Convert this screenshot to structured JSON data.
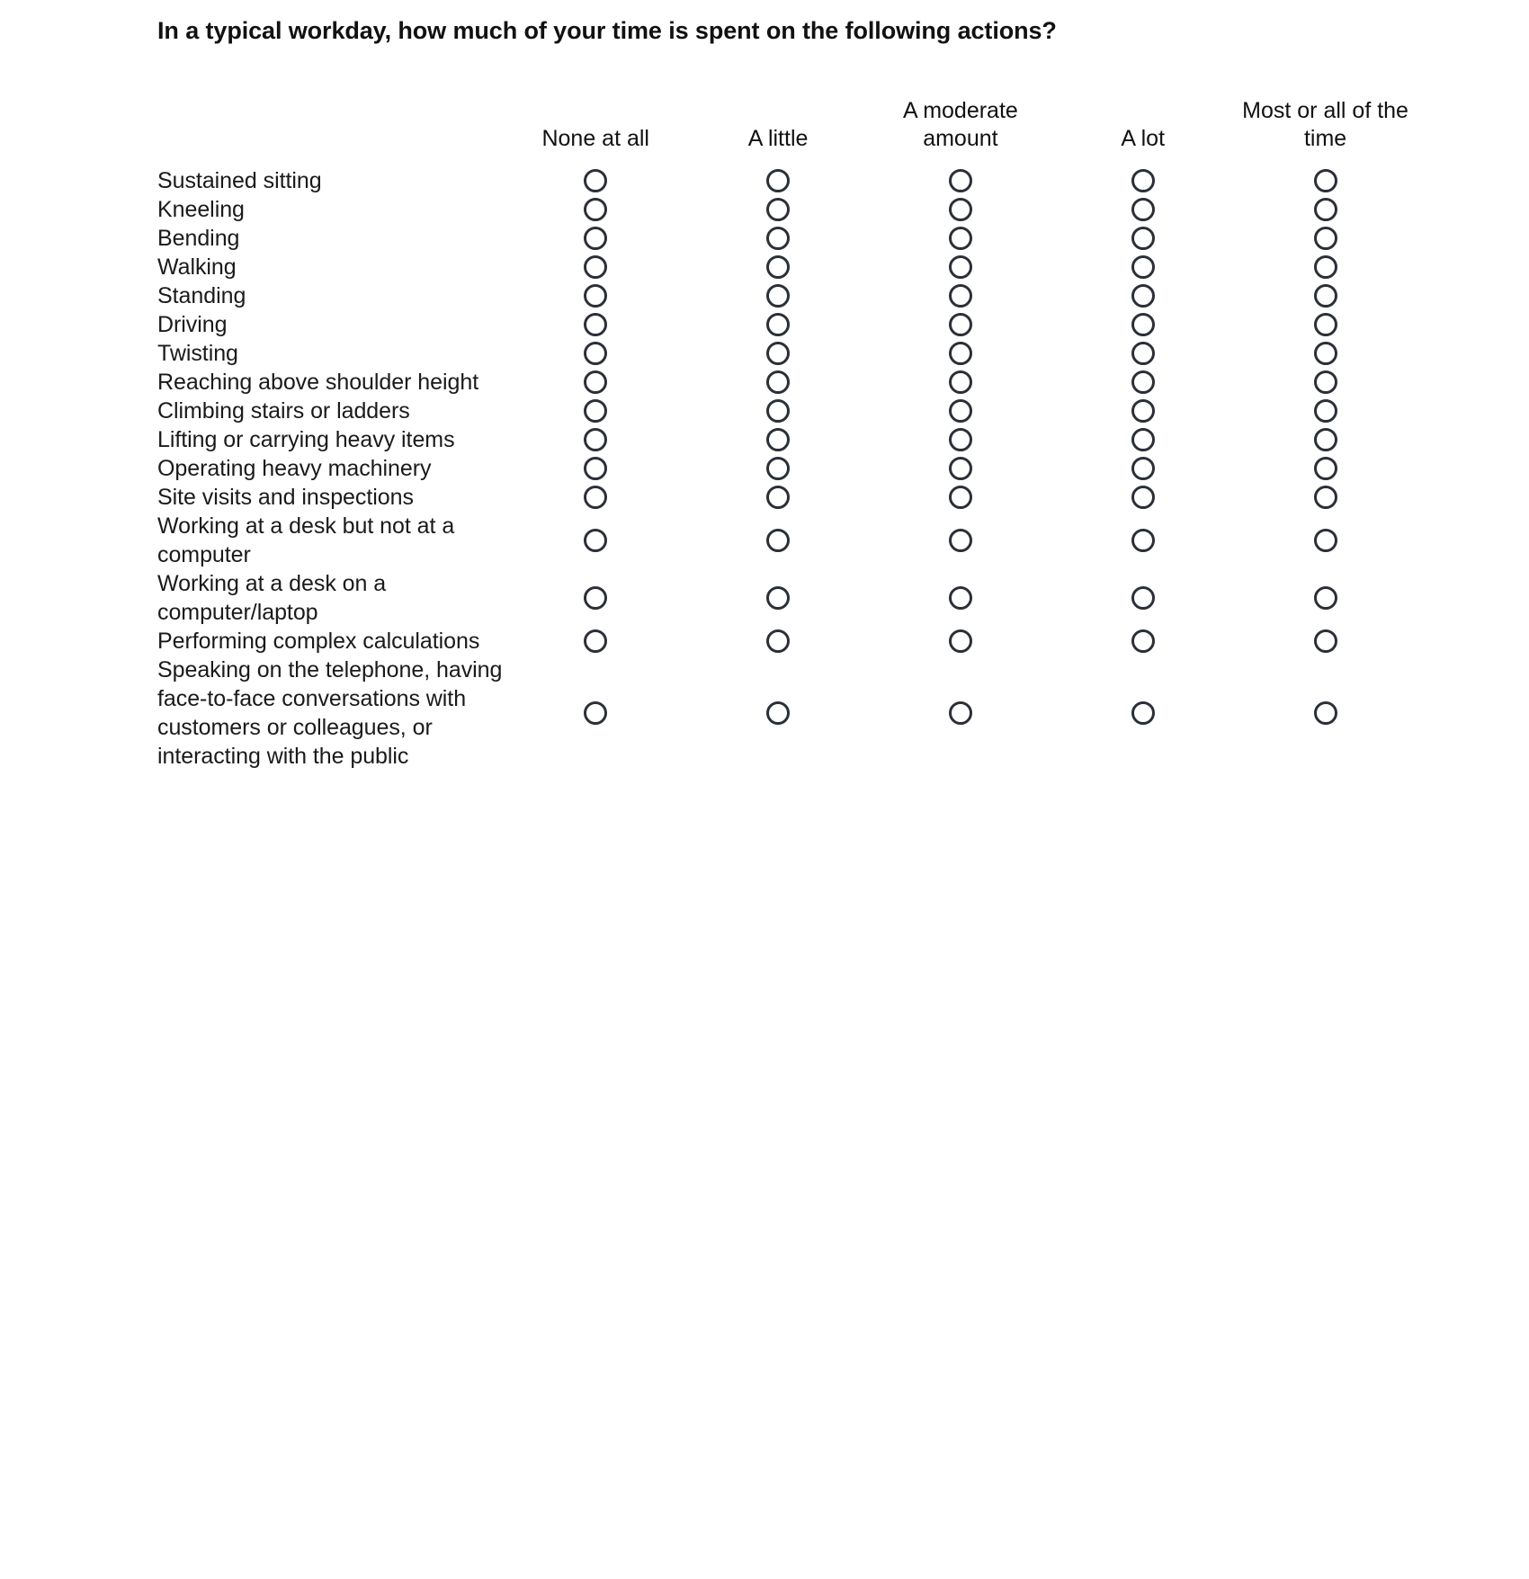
{
  "question": {
    "title": "In a typical workday, how much of your time is spent on the following actions?"
  },
  "matrix": {
    "row_header_label": "",
    "columns": [
      {
        "label": "None at all"
      },
      {
        "label": "A little"
      },
      {
        "label": "A moderate amount"
      },
      {
        "label": "A lot"
      },
      {
        "label": "Most or all of the time"
      }
    ],
    "rows": [
      {
        "label": "Sustained sitting",
        "selected": null
      },
      {
        "label": "Kneeling",
        "selected": null
      },
      {
        "label": "Bending",
        "selected": null
      },
      {
        "label": "Walking",
        "selected": null
      },
      {
        "label": "Standing",
        "selected": null
      },
      {
        "label": "Driving",
        "selected": null
      },
      {
        "label": "Twisting",
        "selected": null
      },
      {
        "label": "Reaching above shoulder height",
        "selected": null
      },
      {
        "label": "Climbing stairs or ladders",
        "selected": null
      },
      {
        "label": "Lifting or carrying heavy items",
        "selected": null
      },
      {
        "label": "Operating heavy machinery",
        "selected": null
      },
      {
        "label": "Site visits and inspections",
        "selected": null
      },
      {
        "label": "Working at a desk but not at a computer",
        "selected": null
      },
      {
        "label": "Working at a desk on a computer/laptop",
        "selected": null
      },
      {
        "label": "Performing complex calculations",
        "selected": null
      },
      {
        "label": "Speaking on the telephone, having face-to-face conversations with customers or colleagues, or interacting with the public",
        "selected": null
      }
    ]
  },
  "colors": {
    "text": "#1a1a1a",
    "radio_border": "#2b2f38",
    "background": "#ffffff"
  }
}
